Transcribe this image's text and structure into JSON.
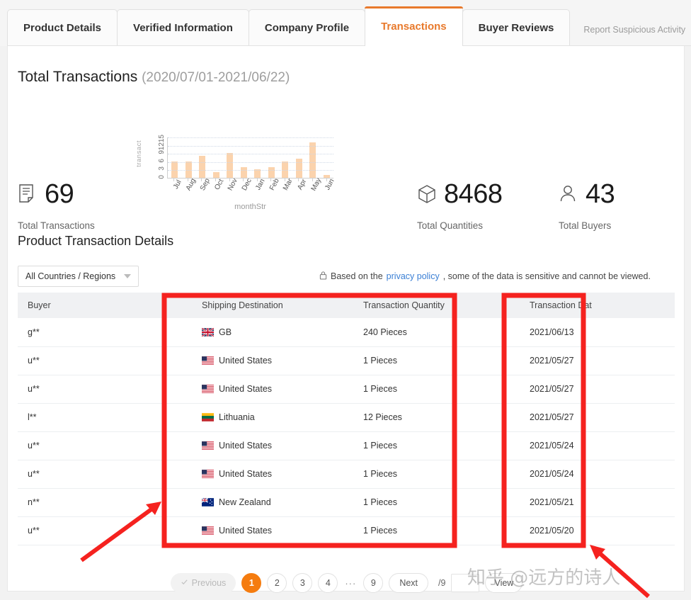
{
  "tabs": [
    {
      "label": "Product Details",
      "active": false
    },
    {
      "label": "Verified Information",
      "active": false
    },
    {
      "label": "Company Profile",
      "active": false
    },
    {
      "label": "Transactions",
      "active": true
    },
    {
      "label": "Buyer Reviews",
      "active": false
    }
  ],
  "report_link": "Report Suspicious Activity",
  "overview": {
    "title": "Total Transactions",
    "date_range": "(2020/07/01-2021/06/22)",
    "stats": [
      {
        "id": "transactions",
        "value": "69",
        "label": "Total Transactions",
        "icon": "document-icon"
      },
      {
        "id": "quantities",
        "value": "8468",
        "label": "Total Quantities",
        "icon": "box-icon"
      },
      {
        "id": "buyers",
        "value": "43",
        "label": "Total Buyers",
        "icon": "user-icon"
      }
    ]
  },
  "chart_data": {
    "type": "bar",
    "title": "",
    "xlabel": "monthStr",
    "ylabel": "transact",
    "categories": [
      "Jul",
      "Aug",
      "Sep",
      "Oct",
      "Nov",
      "Dec",
      "Jan",
      "Feb",
      "Mar",
      "Apr",
      "May",
      "Jun"
    ],
    "values": [
      6,
      6,
      8,
      2,
      9,
      4,
      3,
      4,
      6,
      7,
      13,
      1
    ],
    "yticks": [
      "15",
      "12",
      "9",
      "6",
      "3",
      "0"
    ],
    "ylim": [
      0,
      15
    ],
    "grid": true,
    "legend": "none",
    "bar_color": "#fbd3ad"
  },
  "details": {
    "subtitle": "Product Transaction Details",
    "country_filter": "All Countries / Regions",
    "privacy_notice_prefix": "Based on the ",
    "privacy_link": "privacy policy",
    "privacy_notice_suffix": ", some of the data is sensitive and cannot be viewed.",
    "lock_icon": "lock-icon",
    "columns": [
      "Buyer",
      "Shipping Destination",
      "Transaction Quantity",
      "Transaction Dat"
    ],
    "rows": [
      {
        "buyer": "g**",
        "destination": "GB",
        "flag": "gb",
        "quantity": "240 Pieces",
        "date": "2021/06/13"
      },
      {
        "buyer": "u**",
        "destination": "United States",
        "flag": "us",
        "quantity": "1 Pieces",
        "date": "2021/05/27"
      },
      {
        "buyer": "u**",
        "destination": "United States",
        "flag": "us",
        "quantity": "1 Pieces",
        "date": "2021/05/27"
      },
      {
        "buyer": "l**",
        "destination": "Lithuania",
        "flag": "lt",
        "quantity": "12 Pieces",
        "date": "2021/05/27"
      },
      {
        "buyer": "u**",
        "destination": "United States",
        "flag": "us",
        "quantity": "1 Pieces",
        "date": "2021/05/24"
      },
      {
        "buyer": "u**",
        "destination": "United States",
        "flag": "us",
        "quantity": "1 Pieces",
        "date": "2021/05/24"
      },
      {
        "buyer": "n**",
        "destination": "New Zealand",
        "flag": "nz",
        "quantity": "1 Pieces",
        "date": "2021/05/21"
      },
      {
        "buyer": "u**",
        "destination": "United States",
        "flag": "us",
        "quantity": "1 Pieces",
        "date": "2021/05/20"
      }
    ]
  },
  "pagination": {
    "previous": "Previous",
    "pages": [
      "1",
      "2",
      "3",
      "4"
    ],
    "ellipsis": "···",
    "last_page": "9",
    "next": "Next",
    "current": "1",
    "goto_suffix": "/9",
    "page_input_value": "",
    "view": "View"
  },
  "watermark": "知乎 @远方的诗人",
  "colors": {
    "accent": "#e8792b",
    "pager_active": "#f57c0f",
    "bar": "#fbd3ad",
    "link": "#3a7fd5",
    "annotation": "#f5221f"
  }
}
